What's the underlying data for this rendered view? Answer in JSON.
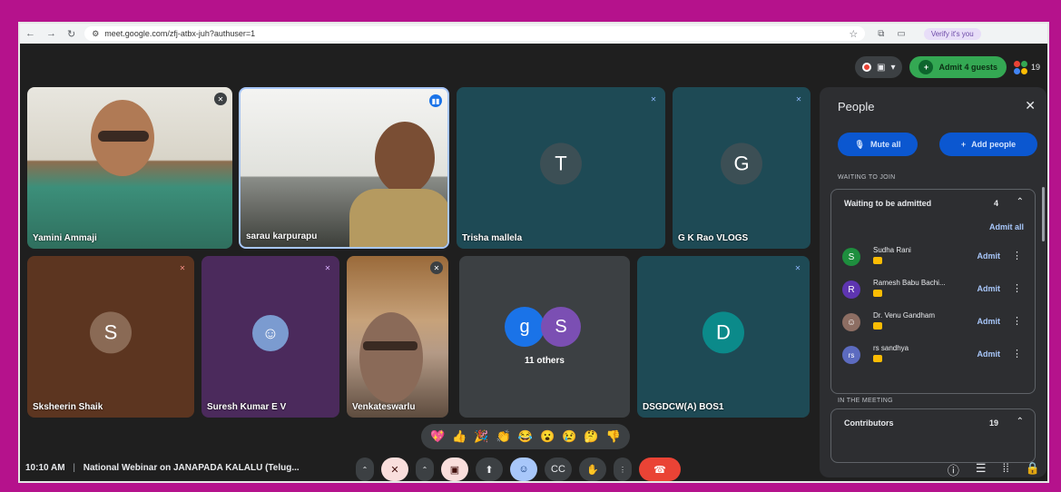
{
  "browser": {
    "url": "meet.google.com/zfj-atbx-juh?authuser=1",
    "verify_label": "Verify it's you"
  },
  "top_controls": {
    "admit_guests_label": "Admit 4 guests",
    "people_count": "19"
  },
  "tiles": [
    {
      "name": "Yamini Ammaji"
    },
    {
      "name": "sarau karpurapu"
    },
    {
      "name": "Trisha mallela",
      "initial": "T"
    },
    {
      "name": "G K Rao VLOGS",
      "initial": "G"
    },
    {
      "name": "Sksheerin Shaik",
      "initial": "S"
    },
    {
      "name": "Suresh Kumar E V"
    },
    {
      "name": "Venkateswarlu"
    },
    {
      "others_label": "11 others",
      "initial_a": "g",
      "initial_b": "S"
    },
    {
      "name": "DSGDCW(A) BOS1",
      "initial": "D"
    }
  ],
  "panel": {
    "title": "People",
    "mute_all": "Mute all",
    "add_people": "Add people",
    "waiting_section": "WAITING TO JOIN",
    "waiting_header": "Waiting to be admitted",
    "waiting_count": "4",
    "admit_all": "Admit all",
    "guests": [
      {
        "initial": "S",
        "name": "Sudha Rani",
        "admit": "Admit",
        "color": "#1e8e3e"
      },
      {
        "initial": "R",
        "name": "Ramesh Babu Bachi...",
        "admit": "Admit",
        "color": "#5e35b1"
      },
      {
        "initial": "",
        "name": "Dr. Venu Gandham",
        "admit": "Admit",
        "color": "#8d6e63"
      },
      {
        "initial": "rs",
        "name": "rs sandhya",
        "admit": "Admit",
        "color": "#5c6bc0"
      }
    ],
    "meeting_section": "IN THE MEETING",
    "contributors_header": "Contributors",
    "contributors_count": "19"
  },
  "bottom": {
    "time": "10:10 AM",
    "meeting_title": "National Webinar on JANAPADA KALALU (Telug..."
  },
  "reactions": [
    "💖",
    "👍",
    "🎉",
    "👏",
    "😂",
    "😮",
    "😢",
    "🤔",
    "👎"
  ],
  "colors": {
    "frame_bg": "#b5128c",
    "meet_bg": "#1f1f1f",
    "accent_blue": "#0b57d0",
    "end_call": "#ea4335"
  }
}
